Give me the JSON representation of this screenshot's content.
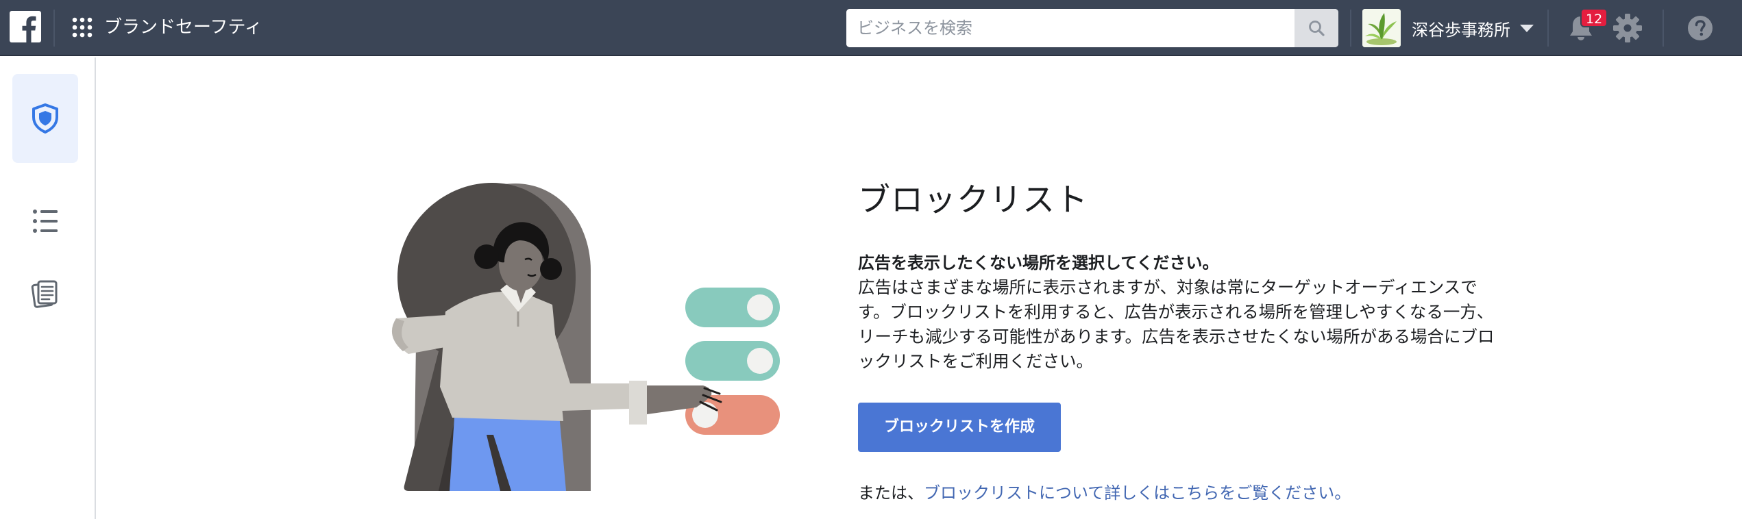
{
  "topbar": {
    "app_title": "ブランドセーフティ",
    "search": {
      "placeholder": "ビジネスを検索",
      "value": ""
    },
    "account": {
      "name": "深谷歩事務所"
    },
    "notifications": {
      "count": "12"
    }
  },
  "rail": {
    "items": [
      {
        "icon": "shield-icon",
        "active": true
      },
      {
        "icon": "list-icon",
        "active": false
      },
      {
        "icon": "documents-icon",
        "active": false
      }
    ]
  },
  "main": {
    "heading": "ブロックリスト",
    "subheading": "広告を表示したくない場所を選択してください。",
    "description": "広告はさまざまな場所に表示されますが、対象は常にターゲットオーディエンスです。ブロックリストを利用すると、広告が表示される場所を管理しやすくなる一方、リーチも減少する可能性があります。広告を表示させたくない場所がある場合にブロックリストをご利用ください。",
    "create_button": "ブロックリストを作成",
    "or_prefix": "または、",
    "learn_more_link": "ブロックリストについて詳しくはこちらをご覧ください。"
  },
  "colors": {
    "topbar": "#3b4556",
    "accent": "#4a76d4",
    "link": "#4267b2",
    "badge": "#e41e3f",
    "toggle_on": "#88cabd",
    "toggle_alert": "#e8917c"
  }
}
